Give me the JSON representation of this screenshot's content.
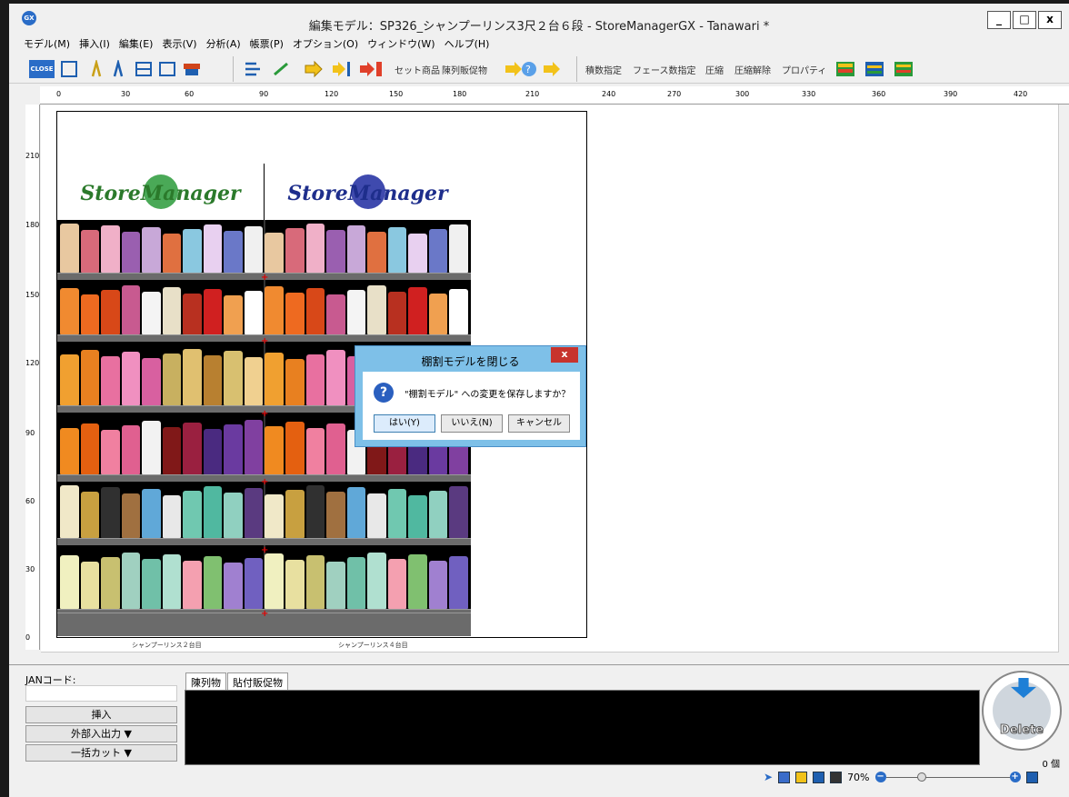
{
  "window": {
    "title": "編集モデル：SP326_シャンプーリンス3尺２台６段 - StoreManagerGX - Tanawari *",
    "app_icon": "GX",
    "minimize": "_",
    "maximize": "□",
    "close": "x"
  },
  "menu": [
    "モデル(M)",
    "挿入(I)",
    "編集(E)",
    "表示(V)",
    "分析(A)",
    "帳票(P)",
    "オプション(O)",
    "ウィンドウ(W)",
    "ヘルプ(H)"
  ],
  "toolbar": {
    "close_label": "CLOSE",
    "set_product": "セット商品",
    "display_promo": "陳列販促物",
    "stack": "積数指定",
    "face": "フェース数指定",
    "compress": "圧縮",
    "decompress": "圧縮解除",
    "properties": "プロパティ"
  },
  "ruler": {
    "h_ticks": [
      "0",
      "30",
      "60",
      "90",
      "120",
      "150",
      "180",
      "210",
      "240",
      "270",
      "300",
      "330",
      "360",
      "390",
      "420"
    ],
    "v_ticks": [
      "210",
      "180",
      "150",
      "120",
      "90",
      "60",
      "30",
      "0"
    ]
  },
  "planogram": {
    "logo_text": "StoreManager",
    "logo_sub": "GX",
    "base_labels": [
      "シャンプーリンス２台目",
      "シャンプーリンス４台目"
    ]
  },
  "dialog": {
    "title": "棚割モデルを閉じる",
    "close": "x",
    "message": "\"棚割モデル\" への変更を保存しますか？",
    "yes": "はい(Y)",
    "no": "いいえ(N)",
    "cancel": "キャンセル"
  },
  "bottom": {
    "jan_label": "JANコード:",
    "insert": "挿入",
    "external_io": "外部入出力 ▼",
    "bulk_cut": "一括カット ▼",
    "tabs": [
      "陳列物",
      "貼付販促物"
    ],
    "delete_label": "Delete",
    "count": "0 個",
    "zoom": "70%"
  },
  "colors": {
    "accent": "#2a6cc7",
    "dialog": "#7ec0e8",
    "close_red": "#c7332d"
  }
}
